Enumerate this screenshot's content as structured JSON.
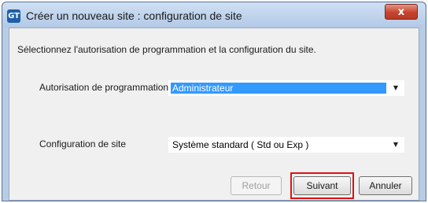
{
  "window": {
    "title": "Créer un nouveau site : configuration de site",
    "app_icon": "GT",
    "close_glyph": "x"
  },
  "instruction": "Sélectionnez l'autorisation de programmation et la configuration du site.",
  "fields": {
    "authorization": {
      "label": "Autorisation de programmation",
      "value": "Administrateur",
      "arrow": "▼"
    },
    "site_config": {
      "label": "Configuration de site",
      "value": "Système standard ( Std ou Exp )",
      "arrow": "▼"
    }
  },
  "buttons": {
    "back": "Retour",
    "next": "Suivant",
    "cancel": "Annuler"
  },
  "colors": {
    "selection": "#3399ff",
    "highlight": "#e01010",
    "close": "#c6442f"
  }
}
